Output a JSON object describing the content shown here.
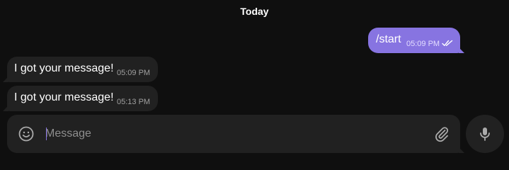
{
  "chat": {
    "date_label": "Today",
    "messages": [
      {
        "direction": "outgoing",
        "text": "/start",
        "time": "05:09 PM",
        "status_icon": "double-check-icon"
      },
      {
        "direction": "incoming",
        "text": "I got your message!",
        "time": "05:09 PM"
      },
      {
        "direction": "incoming",
        "text": "I got your message!",
        "time": "05:13 PM"
      }
    ]
  },
  "composer": {
    "placeholder": "Message",
    "value": "",
    "emoji_icon": "emoji-icon",
    "attach_icon": "paperclip-icon",
    "send_icon": "microphone-icon"
  },
  "colors": {
    "background": "#0f0f0f",
    "outgoing_bubble": "#8774e1",
    "incoming_bubble": "#212121",
    "composer": "#212121",
    "text": "#ffffff",
    "muted": "#a0a0a0"
  }
}
